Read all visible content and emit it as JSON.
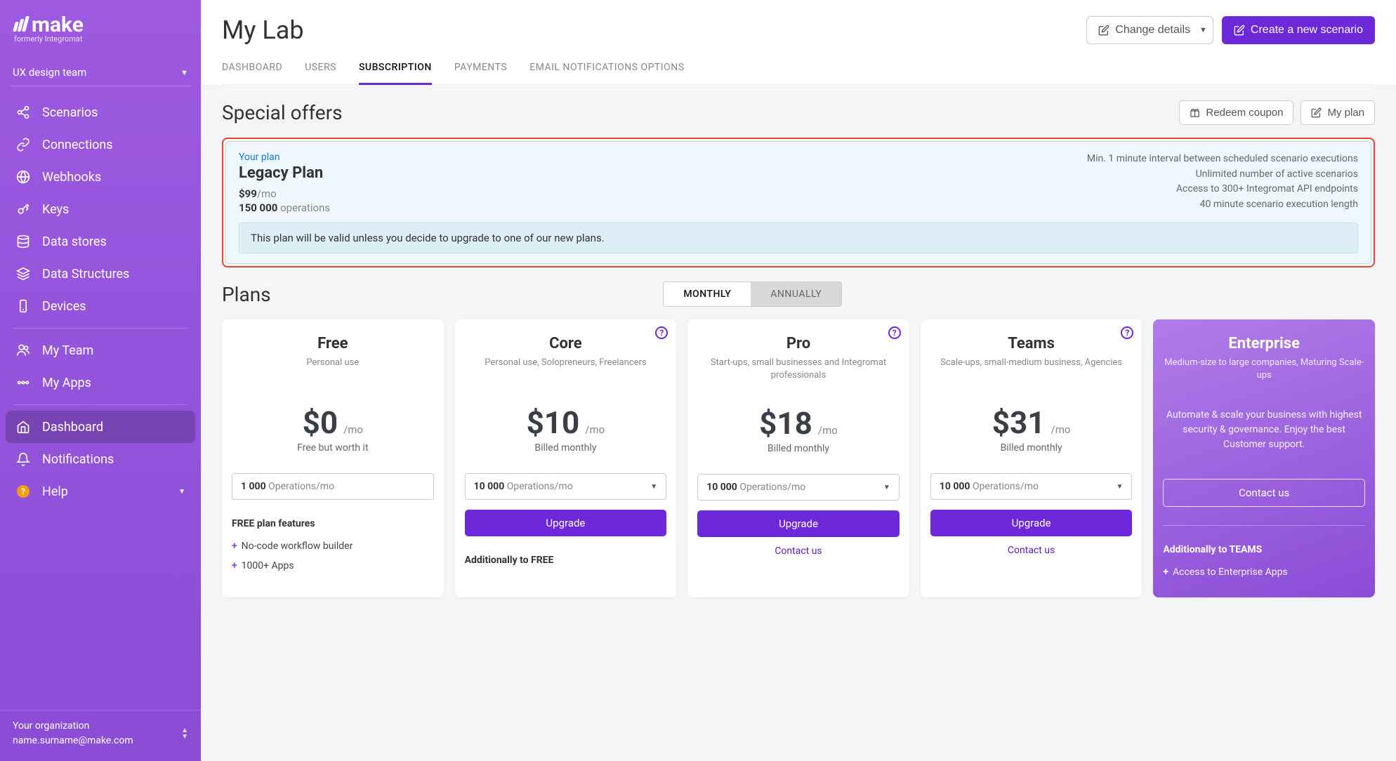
{
  "brand": {
    "name": "make",
    "sub": "formerly Integromat"
  },
  "team": "UX design team",
  "nav": {
    "items": [
      {
        "label": "Scenarios"
      },
      {
        "label": "Connections"
      },
      {
        "label": "Webhooks"
      },
      {
        "label": "Keys"
      },
      {
        "label": "Data stores"
      },
      {
        "label": "Data Structures"
      },
      {
        "label": "Devices"
      }
    ],
    "secondary": [
      {
        "label": "My Team"
      },
      {
        "label": "My Apps"
      }
    ],
    "tertiary": [
      {
        "label": "Dashboard",
        "active": true
      },
      {
        "label": "Notifications"
      },
      {
        "label": "Help"
      }
    ]
  },
  "org": {
    "label": "Your organization",
    "email": "name.surname@make.com"
  },
  "header": {
    "title": "My Lab",
    "change_btn": "Change details",
    "new_btn": "Create a new scenario"
  },
  "tabs": {
    "items": [
      "DASHBOARD",
      "USERS",
      "SUBSCRIPTION",
      "PAYMENTS",
      "EMAIL NOTIFICATIONS OPTIONS"
    ],
    "activeIndex": 2
  },
  "offers": {
    "title": "Special offers",
    "redeem": "Redeem coupon",
    "myplan": "My plan"
  },
  "current_plan": {
    "your_plan": "Your plan",
    "name": "Legacy Plan",
    "price": "$99",
    "per": "/mo",
    "ops_value": "150 000",
    "ops_label": "operations",
    "notes": [
      "Min. 1 minute interval between scheduled scenario executions",
      "Unlimited number of active scenarios",
      "Access to 300+ Integromat API endpoints",
      "40 minute scenario execution length"
    ],
    "notice": "This plan will be valid unless you decide to upgrade to one of our new plans."
  },
  "plans_section": {
    "title": "Plans",
    "period": {
      "monthly": "MONTHLY",
      "annually": "ANNUALLY",
      "active": "monthly"
    }
  },
  "plans": [
    {
      "name": "Free",
      "sub": "Personal use",
      "price": "$0",
      "per": "/mo",
      "bill": "Free but worth it",
      "has_help": false,
      "ops_value": "1 000",
      "ops_unit": "Operations/mo",
      "cta": "",
      "contact": "",
      "features_heading": "FREE plan features",
      "features": [
        "No-code workflow builder",
        "1000+ Apps"
      ]
    },
    {
      "name": "Core",
      "sub": "Personal use, Solopreneurs, Freelancers",
      "price": "$10",
      "per": "/mo",
      "bill": "Billed monthly",
      "has_help": true,
      "ops_value": "10 000",
      "ops_unit": "Operations/mo",
      "cta": "Upgrade",
      "contact": "",
      "features_heading": "Additionally to FREE",
      "features": []
    },
    {
      "name": "Pro",
      "sub": "Start-ups, small businesses and Integromat professionals",
      "price": "$18",
      "per": "/mo",
      "bill": "Billed monthly",
      "has_help": true,
      "ops_value": "10 000",
      "ops_unit": "Operations/mo",
      "cta": "Upgrade",
      "contact": "Contact us",
      "features_heading": "",
      "features": []
    },
    {
      "name": "Teams",
      "sub": "Scale-ups, small-medium business, Agencies",
      "price": "$31",
      "per": "/mo",
      "bill": "Billed monthly",
      "has_help": true,
      "ops_value": "10 000",
      "ops_unit": "Operations/mo",
      "cta": "Upgrade",
      "contact": "Contact us",
      "features_heading": "",
      "features": []
    }
  ],
  "enterprise": {
    "name": "Enterprise",
    "sub": "Medium-size to large companies, Maturing Scale-ups",
    "desc": "Automate & scale your business with highest security & governance. Enjoy the best Customer support.",
    "contact": "Contact us",
    "features_heading": "Additionally to TEAMS",
    "features": [
      "Access to Enterprise Apps"
    ]
  }
}
